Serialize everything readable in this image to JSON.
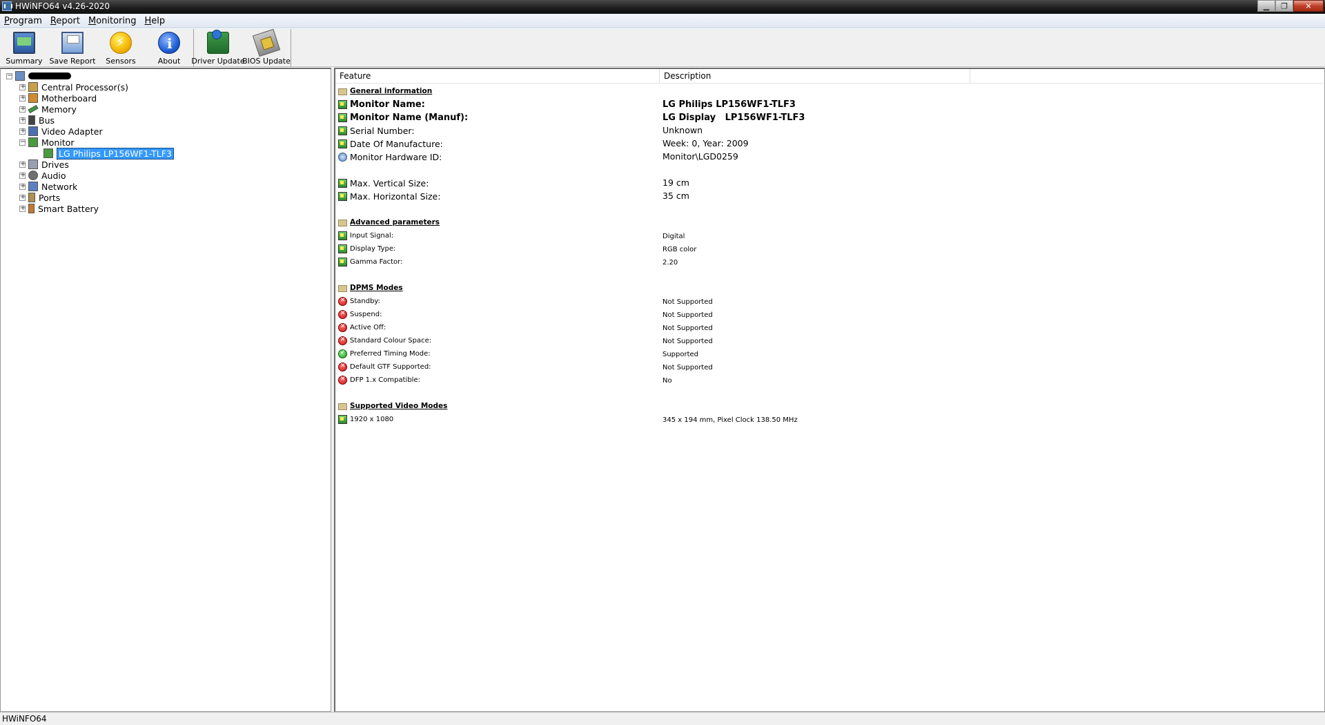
{
  "window": {
    "title": "HWiNFO64 v4.26-2020"
  },
  "menu": [
    {
      "label": "Program",
      "accel": "P",
      "rest": "rogram"
    },
    {
      "label": "Report",
      "accel": "R",
      "rest": "eport"
    },
    {
      "label": "Monitoring",
      "accel": "M",
      "rest": "onitoring"
    },
    {
      "label": "Help",
      "accel": "H",
      "rest": "elp"
    }
  ],
  "toolbar": {
    "summary": "Summary",
    "save_report": "Save Report",
    "sensors": "Sensors",
    "about": "About",
    "driver_update": "Driver Update",
    "bios_update": "BIOS Update"
  },
  "tree": {
    "cpu": "Central Processor(s)",
    "motherboard": "Motherboard",
    "memory": "Memory",
    "bus": "Bus",
    "video": "Video Adapter",
    "monitor": "Monitor",
    "monitor_child": "LG Philips LP156WF1-TLF3",
    "drives": "Drives",
    "audio": "Audio",
    "network": "Network",
    "ports": "Ports",
    "battery": "Smart Battery"
  },
  "table": {
    "col_feature": "Feature",
    "col_description": "Description",
    "general": {
      "title": "General information",
      "monitor_name_label": "Monitor Name:",
      "monitor_name_value": "LG Philips LP156WF1-TLF3",
      "monitor_manuf_label": "Monitor Name (Manuf):",
      "monitor_manuf_value": "LG Display   LP156WF1-TLF3",
      "serial_label": "Serial Number:",
      "serial_value": "Unknown",
      "date_label": "Date Of Manufacture:",
      "date_value": "Week: 0, Year: 2009",
      "hwid_label": "Monitor Hardware ID:",
      "hwid_value": "Monitor\\LGD0259",
      "vsize_label": "Max. Vertical Size:",
      "vsize_value": "19 cm",
      "hsize_label": "Max. Horizontal Size:",
      "hsize_value": "35 cm"
    },
    "advanced": {
      "title": "Advanced parameters",
      "input_label": "Input Signal:",
      "input_value": "Digital",
      "display_label": "Display Type:",
      "display_value": "RGB color",
      "gamma_label": "Gamma Factor:",
      "gamma_value": "2.20"
    },
    "dpms": {
      "title": "DPMS Modes",
      "standby_label": "Standby:",
      "standby_value": "Not Supported",
      "suspend_label": "Suspend:",
      "suspend_value": "Not Supported",
      "activeoff_label": "Active Off:",
      "activeoff_value": "Not Supported",
      "stdcolour_label": "Standard Colour Space:",
      "stdcolour_value": "Not Supported",
      "preftiming_label": "Preferred Timing Mode:",
      "preftiming_value": "Supported",
      "gtf_label": "Default GTF Supported:",
      "gtf_value": "Not Supported",
      "dfp_label": "DFP 1.x Compatible:",
      "dfp_value": "No"
    },
    "video_modes": {
      "title": "Supported Video Modes",
      "mode_label": "1920 x 1080",
      "mode_value": "345 x 194 mm, Pixel Clock 138.50 MHz"
    }
  },
  "status": {
    "text": "HWiNFO64"
  },
  "colors": {
    "selection": "#3399ff",
    "title_bar": "#1c1c1c"
  }
}
